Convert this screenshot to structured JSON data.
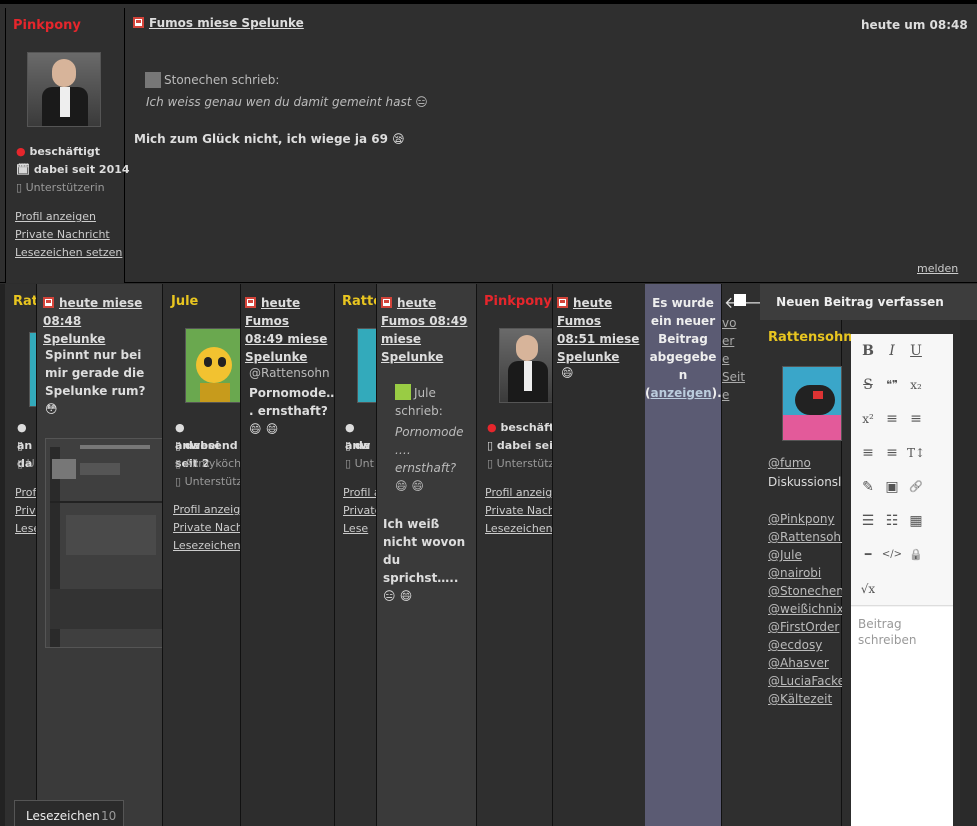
{
  "top_post": {
    "user": "Pinkpony",
    "status": "beschäftigt",
    "since": "dabei seit 2014",
    "rank": "Unterstützerin",
    "links": [
      "Profil anzeigen",
      "Private Nachricht",
      "Lesezeichen setzen"
    ],
    "thread": "Fumos miese Spelunke",
    "time": "heute um 08:48",
    "quote_author": "Stonechen schrieb:",
    "quote_text": "Ich weiss genau wen du damit gemeint hast 😑",
    "body": "Mich zum Glück nicht, ich wiege ja 69 😪",
    "report": "melden"
  },
  "columns": {
    "c1": {
      "user": "Rat",
      "status": "an",
      "since": "da",
      "rank": "U",
      "links": [
        "Profi",
        "Priva",
        "Lese"
      ]
    },
    "c2": {
      "thread_a": "Fumos",
      "thread_b": "Spelunke",
      "mixed_header": "heute miese 08:48",
      "body": "Spinnt nur bei mir gerade die Spelunke rum? 😳"
    },
    "c3": {
      "user": "Jule",
      "status": "anwesend",
      "since": "dabei seit 2",
      "rank_a": "Allmyköchin",
      "rank_b": "Unterstütze",
      "links": [
        "Profil anzeigen",
        "Private Nachri",
        "Lesezeichen s"
      ]
    },
    "c4": {
      "header_a": "heute Fumos",
      "header_b": "08:49 miese",
      "thread": "Spelunke",
      "mention": "@Rattensohn",
      "body": "Pornomode… . ernsthaft? 😄 😄"
    },
    "c5": {
      "user": "Ratte",
      "status": "anw",
      "since": "da",
      "rank": "Unt",
      "links": [
        "Profil a",
        "Private",
        "Lese"
      ]
    },
    "c6": {
      "header": "heute Fumos 08:49",
      "thread_a": "miese",
      "thread_b": "Spelunke",
      "quote_author_a": "Jule",
      "quote_author_b": "schrieb:",
      "quote_text": [
        "Pornomode",
        ".…",
        "ernsthaft?",
        "😄 😄"
      ],
      "body": "Ich weiß nicht wovon du sprichst….. 😑 😄"
    },
    "c7": {
      "user": "Pinkpony",
      "status": "beschäftigt",
      "since": "dabei seit 2",
      "rank": "Unterstütze",
      "links": [
        "Profil anzeige",
        "Private Nachri",
        "Lesezeichen s"
      ]
    },
    "c8": {
      "header_a": "heute Fumos",
      "header_b": "08:51 miese",
      "thread": "Spelunke",
      "body": "😄"
    },
    "c9": {
      "notice": [
        "Es wurde",
        "ein neuer",
        "Beitrag",
        "abgegebe",
        "n"
      ],
      "link_open": "(",
      "link": "anzeigen",
      "link_close": ")."
    },
    "c10": {
      "lines": [
        "vo",
        "er",
        "e",
        "Seit",
        "e"
      ]
    }
  },
  "new_post": {
    "title": "Neuen Beitrag verfassen",
    "user": "Rattensohn",
    "mention_line1": "@fumo",
    "rank": "Diskussionsleit",
    "mentions": [
      "@Pinkpony",
      "@Rattensohn",
      "@Jule",
      "@nairobi",
      "@Stonechen",
      "@weißichnix",
      "@FirstOrder",
      "@ecdosy",
      "@Ahasver",
      "@LuciaFacke",
      "@Kältezeit"
    ],
    "placeholder": "Beitrag schreiben",
    "toolbar": {
      "bold": "B",
      "italic": "I",
      "underline": "U",
      "strike": "S",
      "quote": "❝❞",
      "sub": "x₂",
      "sup": "x²",
      "align_left": "≡",
      "align_center": "≡",
      "align_right": "≡",
      "justify": "≡",
      "font_size": "T↕",
      "pen": "✎",
      "image": "▣",
      "link": "🔗",
      "bullets": "☰",
      "numbers": "☷",
      "table": "▦",
      "line": "━",
      "code": "</>",
      "spoiler": "🔒",
      "formula": "√x"
    }
  },
  "bookmark": {
    "label": "Lesezeichen",
    "count": "10"
  },
  "colors": {
    "accent_user": "#e8c520",
    "pink_user": "#e6262c",
    "notice_bg": "#5b5b73"
  }
}
